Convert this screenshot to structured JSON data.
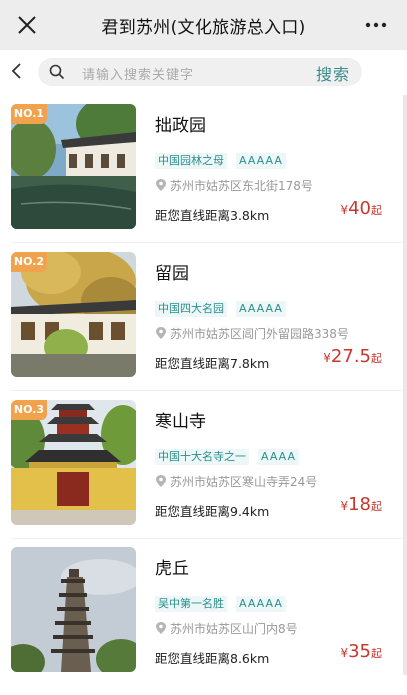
{
  "header": {
    "title": "君到苏州(文化旅游总入口)"
  },
  "search": {
    "placeholder": "请输入搜索关键字",
    "button_label": "搜索"
  },
  "colors": {
    "accent": "#2a8f8c",
    "price": "#c8372d",
    "badge": "#f0a24d"
  },
  "attractions": [
    {
      "rank": "NO.1",
      "name": "拙政园",
      "tag": "中国园林之母",
      "level": "AAAAA",
      "address": "苏州市姑苏区东北街178号",
      "distance": "距您直线距离3.8km",
      "price_currency": "¥",
      "price": "40",
      "price_suffix": "起"
    },
    {
      "rank": "NO.2",
      "name": "留园",
      "tag": "中国四大名园",
      "level": "AAAAA",
      "address": "苏州市姑苏区阊门外留园路338号",
      "distance": "距您直线距离7.8km",
      "price_currency": "¥",
      "price": "27.5",
      "price_suffix": "起"
    },
    {
      "rank": "NO.3",
      "name": "寒山寺",
      "tag": "中国十大名寺之一",
      "level": "AAAA",
      "address": "苏州市姑苏区寒山寺弄24号",
      "distance": "距您直线距离9.4km",
      "price_currency": "¥",
      "price": "18",
      "price_suffix": "起"
    },
    {
      "rank": "",
      "name": "虎丘",
      "tag": "吴中第一名胜",
      "level": "AAAAA",
      "address": "苏州市姑苏区山门内8号",
      "distance": "距您直线距离8.6km",
      "price_currency": "¥",
      "price": "35",
      "price_suffix": "起"
    }
  ]
}
